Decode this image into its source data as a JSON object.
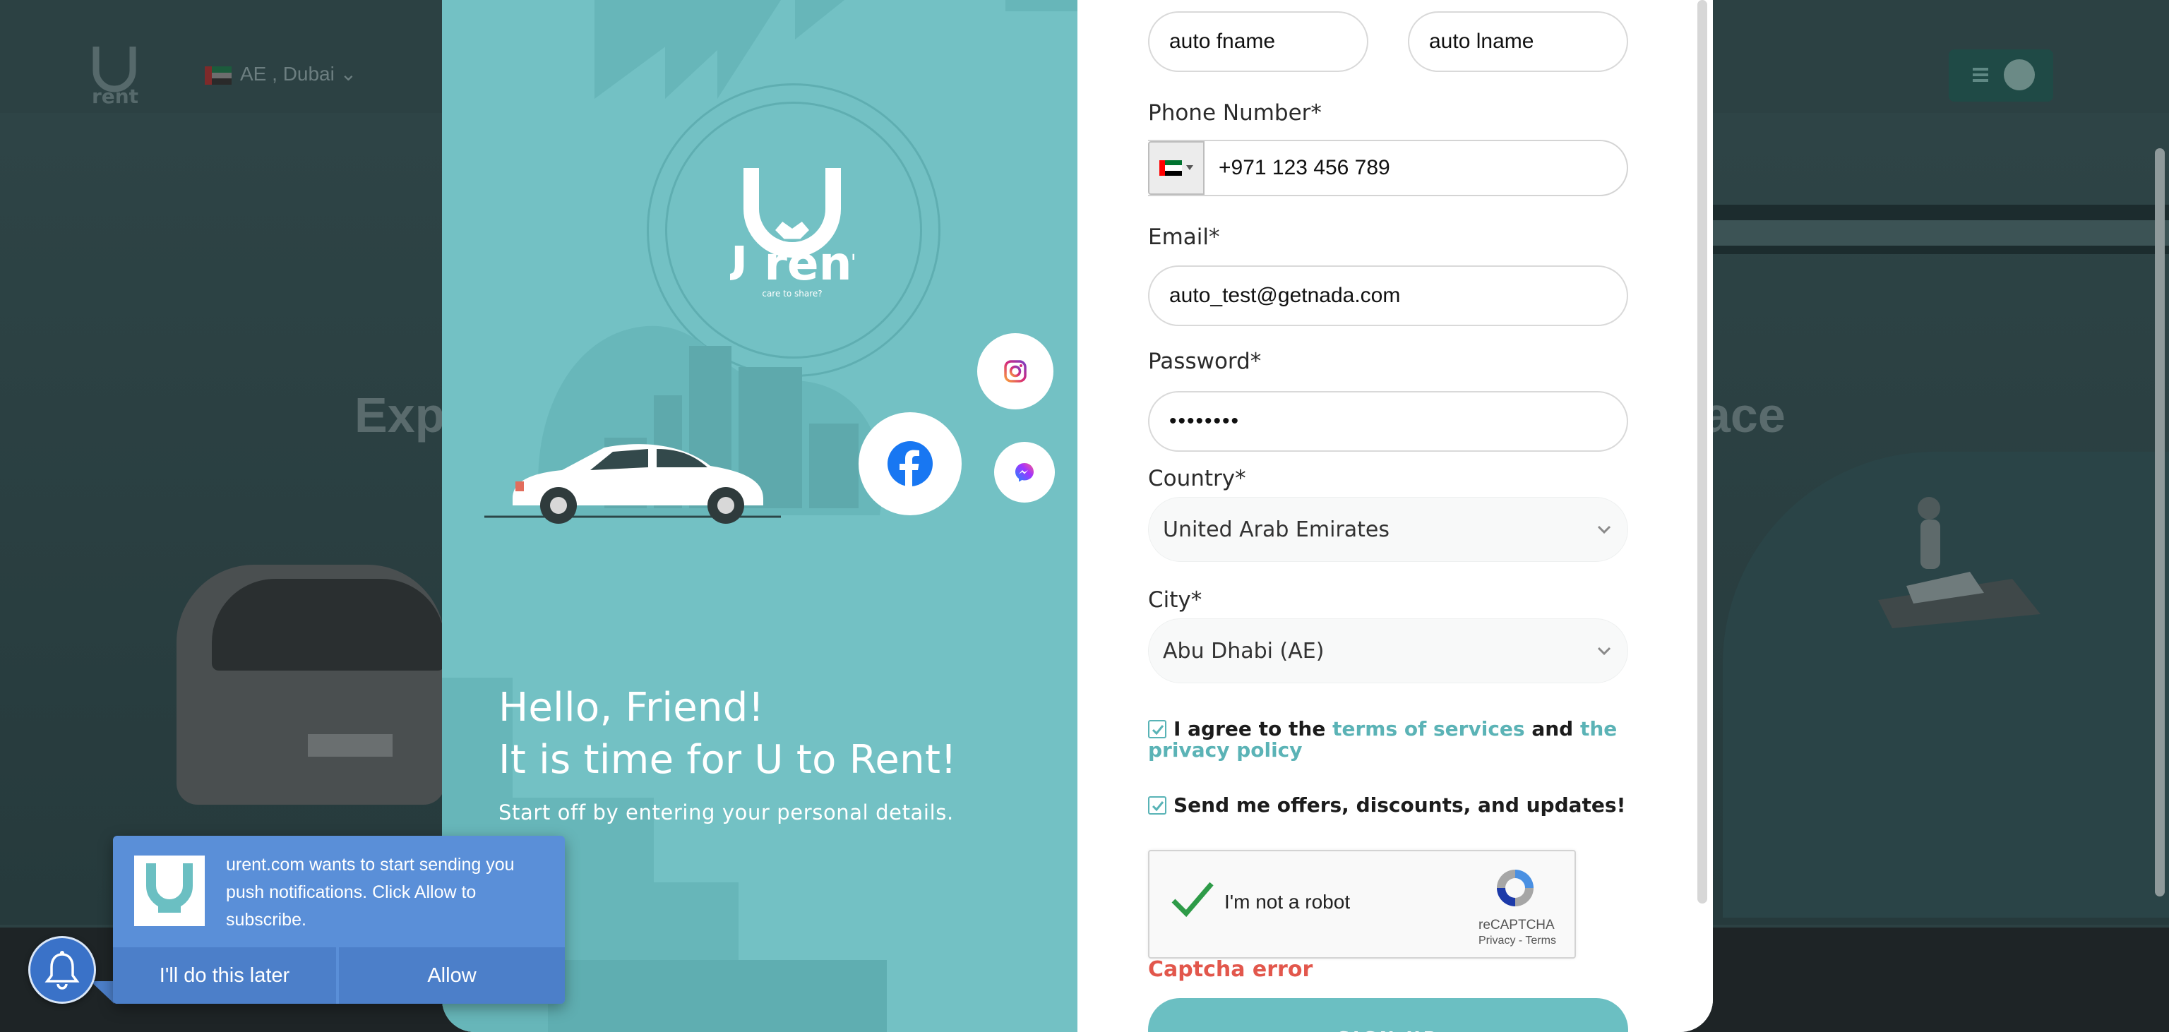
{
  "background": {
    "nav": {
      "location": "AE , Dubai"
    },
    "hero_heading_left": "Exp",
    "hero_heading_right": "ace"
  },
  "brand": {
    "name": "U rent",
    "tagline": "care to share?"
  },
  "welcome": {
    "title_line1": "Hello, Friend!",
    "title_line2": "It is time for U to Rent!",
    "subtitle": "Start off by entering your personal details."
  },
  "social": [
    {
      "icon": "instagram-icon"
    },
    {
      "icon": "facebook-icon"
    },
    {
      "icon": "messenger-icon"
    }
  ],
  "form": {
    "first_name": {
      "value": "auto fname"
    },
    "last_name": {
      "value": "auto lname"
    },
    "phone": {
      "label": "Phone Number*",
      "value": "+971 123 456 789",
      "country_flag": "ae-flag-icon"
    },
    "email": {
      "label": "Email*",
      "value": "auto_test@getnada.com"
    },
    "password": {
      "label": "Password*",
      "value": "••••••••"
    },
    "country": {
      "label": "Country*",
      "value": "United Arab Emirates"
    },
    "city": {
      "label": "City*",
      "value": "Abu Dhabi (AE)"
    },
    "terms": {
      "checked": true,
      "prefix": "I agree to the",
      "link1": "terms of services",
      "middle": "and",
      "link2": "the privacy policy"
    },
    "offers": {
      "checked": true,
      "label": "Send me offers, discounts, and updates!"
    },
    "recaptcha": {
      "label": "I'm not a robot",
      "brand": "reCAPTCHA",
      "privacy": "Privacy",
      "separator": "-",
      "terms": "Terms"
    },
    "captcha_error": "Captcha error",
    "submit": "SIGN UP"
  },
  "push_prompt": {
    "message": "urent.com wants to start sending you push notifications. Click Allow to subscribe.",
    "later": "I'll do this later",
    "allow": "Allow"
  },
  "colors": {
    "teal_panel": "#73c1c4",
    "accent": "#5bb3b6",
    "error": "#e2574c",
    "push_blue": "#5a8fd8"
  }
}
